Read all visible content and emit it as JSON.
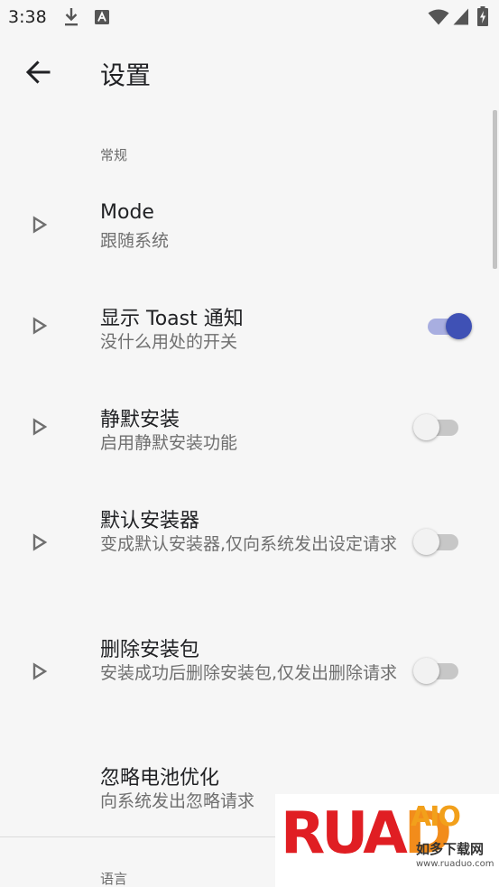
{
  "status_bar": {
    "time": "3:38",
    "icons": [
      "download-icon",
      "text-notification-icon",
      "wifi-icon",
      "signal-icon",
      "battery-charging-icon"
    ]
  },
  "app_bar": {
    "back_icon": "arrow-back-icon",
    "title": "设置"
  },
  "sections": [
    {
      "header": "常规"
    },
    {
      "header": "语言"
    }
  ],
  "preferences": [
    {
      "title": "Mode",
      "summary": "跟随系统",
      "arrow_icon": "play-arrow-icon",
      "switch": null
    },
    {
      "title": "显示 Toast 通知",
      "summary": "没什么用处的开关",
      "arrow_icon": "play-arrow-icon",
      "switch": true
    },
    {
      "title": "静默安装",
      "summary": "启用静默安装功能",
      "arrow_icon": "play-arrow-icon",
      "switch": false
    },
    {
      "title": "默认安装器",
      "summary": "变成默认安装器,仅向系统发出设定请求",
      "arrow_icon": "play-arrow-icon",
      "switch": false
    },
    {
      "title": "删除安装包",
      "summary": "安装成功后删除安装包,仅发出删除请求",
      "arrow_icon": "play-arrow-icon",
      "switch": false
    },
    {
      "title": "忽略电池优化",
      "summary": "向系统发出忽略请求",
      "arrow_icon": null,
      "switch": null
    }
  ],
  "colors": {
    "accent": "#3f51b5",
    "accent_track": "#a8aee0",
    "background": "#f6f6f6"
  },
  "watermark": {
    "logo": "RUANDAIO",
    "tagline": "如多下载网",
    "url": "www.ruaduo.com"
  }
}
